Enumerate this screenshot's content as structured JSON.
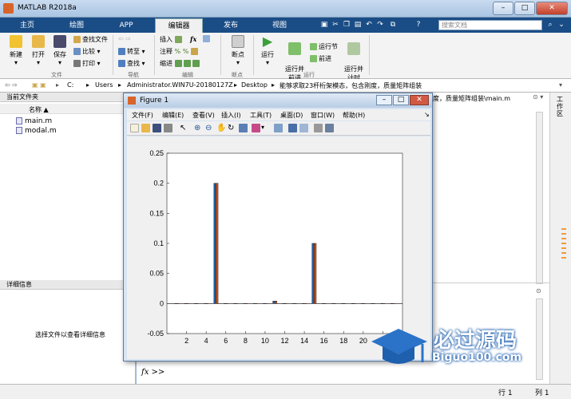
{
  "window": {
    "title": "MATLAB R2018a"
  },
  "tabs": [
    "主页",
    "绘图",
    "APP",
    "编辑器",
    "发布",
    "视图"
  ],
  "search": {
    "placeholder": "搜索文档"
  },
  "ribbon": {
    "new": "新建",
    "open": "打开",
    "save": "保存",
    "find_files": "查找文件",
    "compare": "比较",
    "print": "打印",
    "goto": "转至",
    "find": "查找",
    "insert": "插入",
    "fx": "fx",
    "comment": "注释",
    "indent": "缩进",
    "breakpoints": "断点",
    "run": "运行",
    "run_advance": "运行并\n前进",
    "run_section": "运行节",
    "advance": "前进",
    "run_time": "运行并\n计时",
    "groups": {
      "file": "文件",
      "navigate": "导航",
      "edit": "编辑",
      "breakpoints": "断点",
      "run": "运行"
    }
  },
  "address": {
    "path": [
      "C:",
      "Users",
      "Administrator.WIN7U-20180127Z",
      "Desktop",
      "能够求取23杆桁架模态，包含刚度，质量矩阵组装"
    ]
  },
  "current_folder": {
    "title": "当前文件夹",
    "column_name": "名称 ▲",
    "files": [
      "main.m",
      "modal.m"
    ]
  },
  "details": {
    "title": "详细信息",
    "message": "选择文件以查看详细信息"
  },
  "editor": {
    "path_fragment": "度，质量矩阵组装\\main.m"
  },
  "command": {
    "prompt": "fx >>"
  },
  "right_strip": {
    "label": "工作区"
  },
  "status": {
    "row_label": "行 1",
    "col_label": "列 1"
  },
  "figure": {
    "title": "Figure 1",
    "menu": [
      "文件(F)",
      "编辑(E)",
      "查看(V)",
      "插入(I)",
      "工具(T)",
      "桌面(D)",
      "窗口(W)",
      "帮助(H)"
    ]
  },
  "chart_data": {
    "type": "bar",
    "x": [
      1,
      2,
      3,
      4,
      5,
      6,
      7,
      8,
      9,
      10,
      11,
      12,
      13,
      14,
      15,
      16,
      17,
      18,
      19,
      20,
      21,
      22,
      23
    ],
    "series": [
      {
        "values": [
          0,
          0,
          0,
          0,
          0.2,
          0,
          0,
          0,
          0,
          0,
          0.004,
          0,
          0,
          0,
          0.1,
          0,
          0,
          0,
          0,
          0,
          0,
          0,
          0
        ],
        "color": "#1f5fa8"
      },
      {
        "values": [
          0,
          0,
          0,
          0,
          0.2,
          0,
          0,
          0,
          0,
          0,
          0.004,
          0,
          0,
          0,
          0.1,
          0,
          0,
          0,
          0,
          0,
          0,
          0,
          0
        ],
        "color": "#d9541a"
      }
    ],
    "xticks": [
      "2",
      "4",
      "6",
      "8",
      "10",
      "12",
      "14",
      "16",
      "18",
      "20",
      "22"
    ],
    "yticks": [
      "-0.05",
      "0",
      "0.05",
      "0.1",
      "0.15",
      "0.2",
      "0.25"
    ],
    "xlim": [
      0,
      24
    ],
    "ylim": [
      -0.05,
      0.25
    ],
    "grid": false
  },
  "watermark": {
    "cn": "必过源码",
    "en": "Biguo100.com"
  }
}
